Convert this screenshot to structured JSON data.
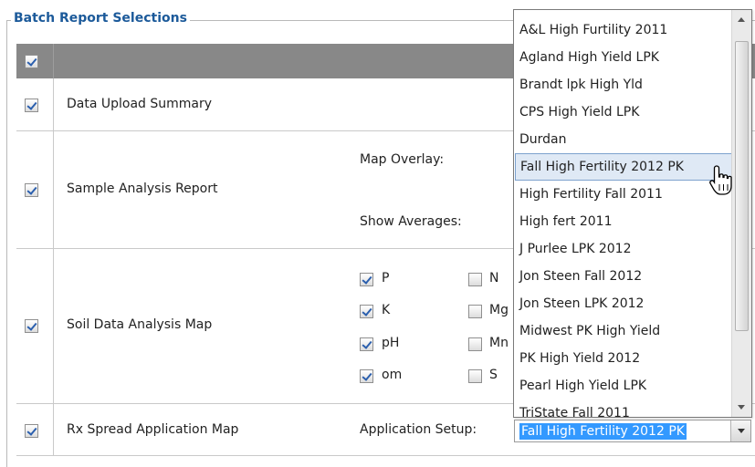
{
  "legend": "Batch Report Selections",
  "rows": {
    "data_upload": {
      "label": "Data Upload Summary",
      "checked": true
    },
    "sample_analysis": {
      "label": "Sample Analysis Report",
      "map_overlay_label": "Map Overlay:",
      "show_averages_label": "Show Averages:",
      "checked": true
    },
    "soil_data": {
      "label": "Soil Data Analysis Map",
      "checked": true,
      "options": [
        {
          "label": "P",
          "checked": true
        },
        {
          "label": "K",
          "checked": true
        },
        {
          "label": "pH",
          "checked": true
        },
        {
          "label": "om",
          "checked": true
        },
        {
          "label": "N",
          "checked": false
        },
        {
          "label": "Mg",
          "checked": false
        },
        {
          "label": "Mn",
          "checked": false
        },
        {
          "label": "S",
          "checked": false
        }
      ]
    },
    "rx_spread": {
      "label": "Rx Spread Application Map",
      "setup_label": "Application Setup:",
      "checked": true
    }
  },
  "select": {
    "value": "Fall High Fertility 2012 PK"
  },
  "dropdown": {
    "hovered_index": 5,
    "items": [
      "A&L High Furtility 2011",
      "Agland High Yield LPK",
      "Brandt lpk High Yld",
      "CPS High Yield LPK",
      "Durdan",
      "Fall High Fertility 2012 PK",
      "High Fertility Fall 2011",
      "High fert 2011",
      "J Purlee LPK 2012",
      "Jon Steen Fall 2012",
      "Jon Steen LPK 2012",
      "Midwest PK High Yield",
      "PK High Yield 2012",
      "Pearl High Yield LPK",
      "TriState Fall 2011"
    ]
  },
  "colors": {
    "legend": "#1c5a9a",
    "header": "#888888",
    "selection": "#3399ff"
  }
}
